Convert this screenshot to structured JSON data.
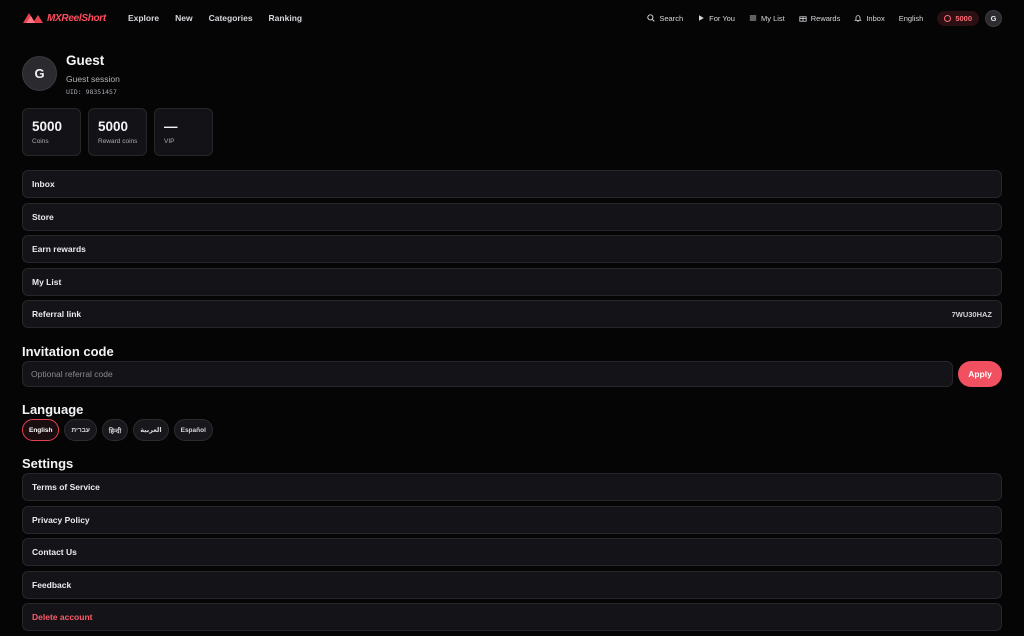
{
  "brand": {
    "name": "MXReelShort",
    "accent": "#ff4d5e"
  },
  "nav": {
    "left": [
      "Explore",
      "New",
      "Categories",
      "Ranking"
    ],
    "right": [
      {
        "label": "Search",
        "icon": "search-icon"
      },
      {
        "label": "For You",
        "icon": "play-icon"
      },
      {
        "label": "My List",
        "icon": "list-icon"
      },
      {
        "label": "Rewards",
        "icon": "gift-icon"
      },
      {
        "label": "Inbox",
        "icon": "bell-icon"
      },
      {
        "label": "English",
        "icon": ""
      }
    ],
    "coins": "5000",
    "avatar_initial": "G"
  },
  "profile": {
    "initial": "G",
    "name": "Guest",
    "session": "Guest session",
    "uid": "UID: 98351457"
  },
  "stats": [
    {
      "value": "5000",
      "label": "Coins"
    },
    {
      "value": "5000",
      "label": "Reward coins"
    },
    {
      "value": "—",
      "label": "VIP"
    }
  ],
  "menu": [
    {
      "label": "Inbox",
      "value": ""
    },
    {
      "label": "Store",
      "value": ""
    },
    {
      "label": "Earn rewards",
      "value": ""
    },
    {
      "label": "My List",
      "value": ""
    },
    {
      "label": "Referral link",
      "value": "7WU30HAZ"
    }
  ],
  "invitation": {
    "title": "Invitation code",
    "placeholder": "Optional referral code",
    "apply_label": "Apply"
  },
  "language": {
    "title": "Language",
    "options": [
      "English",
      "עברית",
      "हिन्दी",
      "العربية",
      "Español"
    ],
    "selected": "English"
  },
  "settings": {
    "title": "Settings",
    "items": [
      "Terms of Service",
      "Privacy Policy",
      "Contact Us",
      "Feedback",
      "Delete account"
    ]
  }
}
